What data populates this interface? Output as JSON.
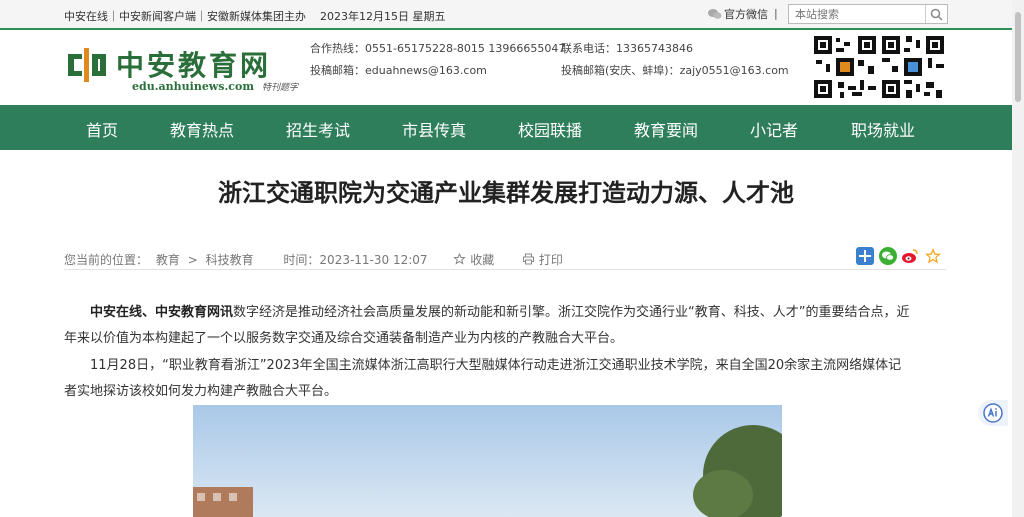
{
  "topbar": {
    "left_text": "中安在线｜中安新闻客户端｜安徽新媒体集团主办",
    "date": "2023年12月15日 星期五",
    "wechat_label": "官方微信",
    "separator": "|",
    "search_placeholder": "本站搜索"
  },
  "header": {
    "logo_name": "中安教育网",
    "logo_url": "edu.anhuinews.com",
    "logo_signature": "特刊题字",
    "hotline": "合作热线：0551-65175228-8015 13966655047",
    "email": "投稿邮箱：eduahnews@163.com",
    "phone": "联系电话：13365743846",
    "email_regional": "投稿邮箱(安庆、蚌埠)：zajy0551@163.com"
  },
  "nav": {
    "items": [
      "首页",
      "教育热点",
      "招生考试",
      "市县传真",
      "校园联播",
      "教育要闻",
      "小记者",
      "职场就业"
    ]
  },
  "article": {
    "title": "浙江交通职院为交通产业集群发展打造动力源、人才池",
    "breadcrumb_label": "您当前的位置：",
    "breadcrumb_home": "教育",
    "breadcrumb_sep": ">",
    "breadcrumb_section": "科技教育",
    "time": "时间：2023-11-30 12:07",
    "favorite": "收藏",
    "print": "打印",
    "p1_lead": "中安在线、中安教育网讯",
    "p1_rest": "数字经济是推动经济社会高质量发展的新动能和新引擎。浙江交院作为交通行业“教育、科技、人才”的重要结合点，近年来以价值为本构建起了一个以服务数字交通及综合交通装备制造产业为内核的产教融合大平台。",
    "p2": "11月28日，“职业教育看浙江”2023年全国主流媒体浙江高职行大型融媒体行动走进浙江交通职业技术学院，来自全国20余家主流网络媒体记者实地探访该校如何发力构建产教融合大平台。"
  },
  "colors": {
    "nav_bg": "#2e7d5b",
    "brand_green": "#2a6f3a"
  }
}
